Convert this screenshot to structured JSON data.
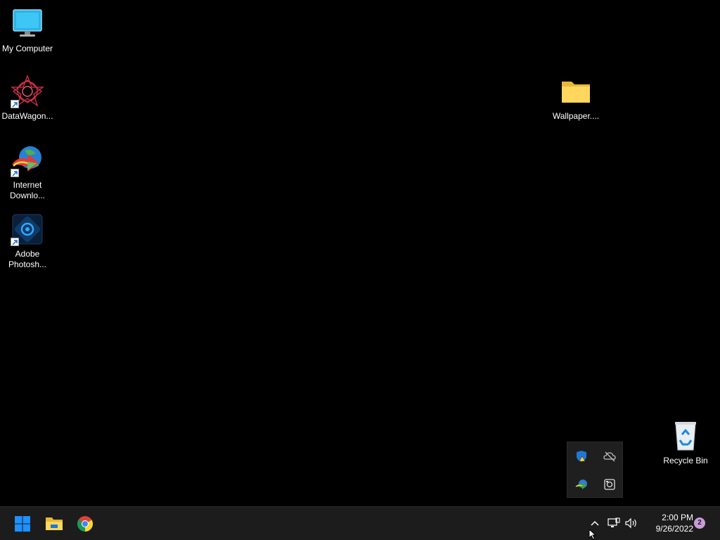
{
  "desktop": {
    "icons": [
      {
        "label": "My Computer",
        "icon": "monitor-icon"
      },
      {
        "label": "DataWagon...",
        "icon": "datawagon-icon"
      },
      {
        "label": "Internet Downlo...",
        "icon": "internet-download-manager-icon"
      },
      {
        "label": "Adobe Photosh...",
        "icon": "adobe-photoshop-icon"
      },
      {
        "label": "Wallpaper....",
        "icon": "folder-icon"
      },
      {
        "label": "Recycle Bin",
        "icon": "recycle-bin-icon"
      }
    ]
  },
  "tray_overflow": {
    "icons": [
      "windows-security-warning-icon",
      "onedrive-offline-icon",
      "internet-download-manager-tray-icon",
      "capture-tool-icon"
    ]
  },
  "taskbar": {
    "pinned": [
      "start-button",
      "file-explorer",
      "google-chrome"
    ],
    "clock": {
      "time": "2:00 PM",
      "date": "9/26/2022"
    },
    "notification_count": "2"
  },
  "colors": {
    "desktop_bg": "#000000",
    "taskbar_bg": "#1c1c1c",
    "accent_blue": "#1e90ff",
    "badge": "#c99bd8"
  }
}
